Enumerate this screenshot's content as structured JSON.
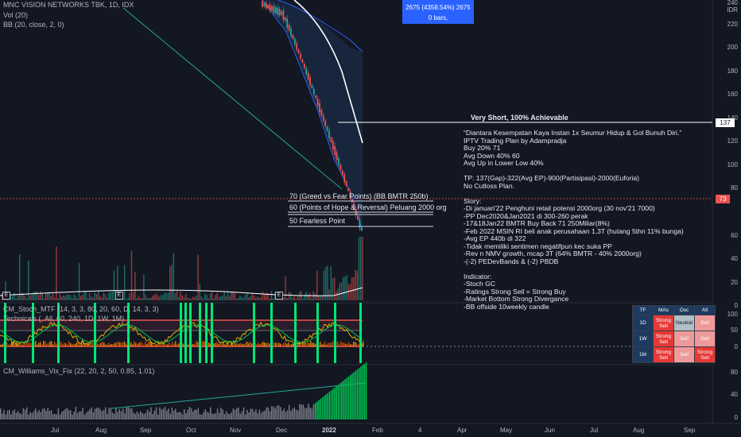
{
  "header": {
    "symbol": "MNC VISION NETWORKS TBK, 1D, IDX",
    "vol": "Vol (20)",
    "bb": "BB (20, close, 2, 0)"
  },
  "indicators": {
    "stoch": "CM_Stoch_MTF (14, 3, 3, 80, 20, 60, D, 14, 3, 3)",
    "technicals": "Technicals (, All, 60, 240, 1D, 1W, 1M)",
    "williams": "CM_Williams_Vix_Fix (22, 20, 2, 50, 0.85, 1.01)"
  },
  "tooltip": {
    "line1": "2675 (4358.54%) 2675",
    "line2": "0 bars,"
  },
  "price_axis": {
    "currency": "IDR",
    "labels": [
      "240",
      "220",
      "200",
      "180",
      "160",
      "140",
      "120",
      "100",
      "80",
      "60",
      "40",
      "20",
      "0"
    ],
    "current_price": "73",
    "target_price": "137"
  },
  "osc_axis": [
    "100",
    "50",
    "0"
  ],
  "vix_axis": [
    "80",
    "40",
    "0"
  ],
  "time_axis": [
    {
      "label": "Jul",
      "bold": false
    },
    {
      "label": "Aug",
      "bold": false
    },
    {
      "label": "Sep",
      "bold": false
    },
    {
      "label": "Oct",
      "bold": false
    },
    {
      "label": "Nov",
      "bold": false
    },
    {
      "label": "Dec",
      "bold": false
    },
    {
      "label": "2022",
      "bold": true
    },
    {
      "label": "Feb",
      "bold": false
    },
    {
      "label": "4",
      "bold": false
    },
    {
      "label": "Apr",
      "bold": false
    },
    {
      "label": "May",
      "bold": false
    },
    {
      "label": "Jun",
      "bold": false
    },
    {
      "label": "Jul",
      "bold": false
    },
    {
      "label": "Aug",
      "bold": false
    },
    {
      "label": "Sep",
      "bold": false
    }
  ],
  "annotations": {
    "target_label": "Very Short, 100% Achievable",
    "fib70": "70 (Greed vs Fear Points) (BB BMTR 250b)",
    "fib60": "60 (Points of Hope & Reversal) Peluang 2000 org",
    "fib50": "50 Fearless Point",
    "note": "“Diantara Kesempatan Kaya Instan 1x Seumur Hidup & Gol Bunuh Diri.”\nIPTV Trading Plan by Adampradja\nBuy 20% 71\nAvg Down 40% 60\nAvg Up in Lower Low 40%\n\nTP: 137(Gap)-322(Avg EP)-900(Partisipasi)-2000(Euforia)\nNo Cutloss Plan.\n\nStory:\n-Di januari'22 Penghuni retail potensi 2000org (30 nov'21 7000)\n-PP Dec2020&Jan2021 di 300-260 perak\n-17&18Jan22 BMTR Buy Back 71 250Miliar(8%)\n-Feb 2022 MSIN RI beli anak perusahaan 1,3T (hutang 5thn 11% bunga)\n-Avg EP 440b di 322\n-Tidak memiliki sentimen negatifpun kec suka PP\n-Rev n NMV growth, mcap 3T (64% BMTR - 40% 2000org)\n-(-2) PEDevBands & (-2) PBDB\n\nIndicator:\n-Stoch GC\n-Ratings Strong Sell = Strong Buy\n-Market Bottom Strong Divergance\n-BB offside 10weekly candle"
  },
  "ratings_table": {
    "headers": [
      "TF",
      "MAs",
      "Osc",
      "All"
    ],
    "rows": [
      {
        "tf": "1D",
        "mas": "Strong Sell",
        "osc": "Neutral",
        "all": "Sell"
      },
      {
        "tf": "1W",
        "mas": "Strong Sell",
        "osc": "Sell",
        "all": "Sell"
      },
      {
        "tf": "1M",
        "mas": "Strong Sell",
        "osc": "Sell",
        "all": "Strong Sell"
      }
    ]
  },
  "markers": {
    "earnings": "E"
  },
  "colors": {
    "background": "#131722",
    "up": "#26a69a",
    "down": "#ef5350",
    "bb_band": "#2962ff",
    "white_line": "#ffffff",
    "green_signal": "#00e676",
    "tooltip": "#2962ff"
  }
}
